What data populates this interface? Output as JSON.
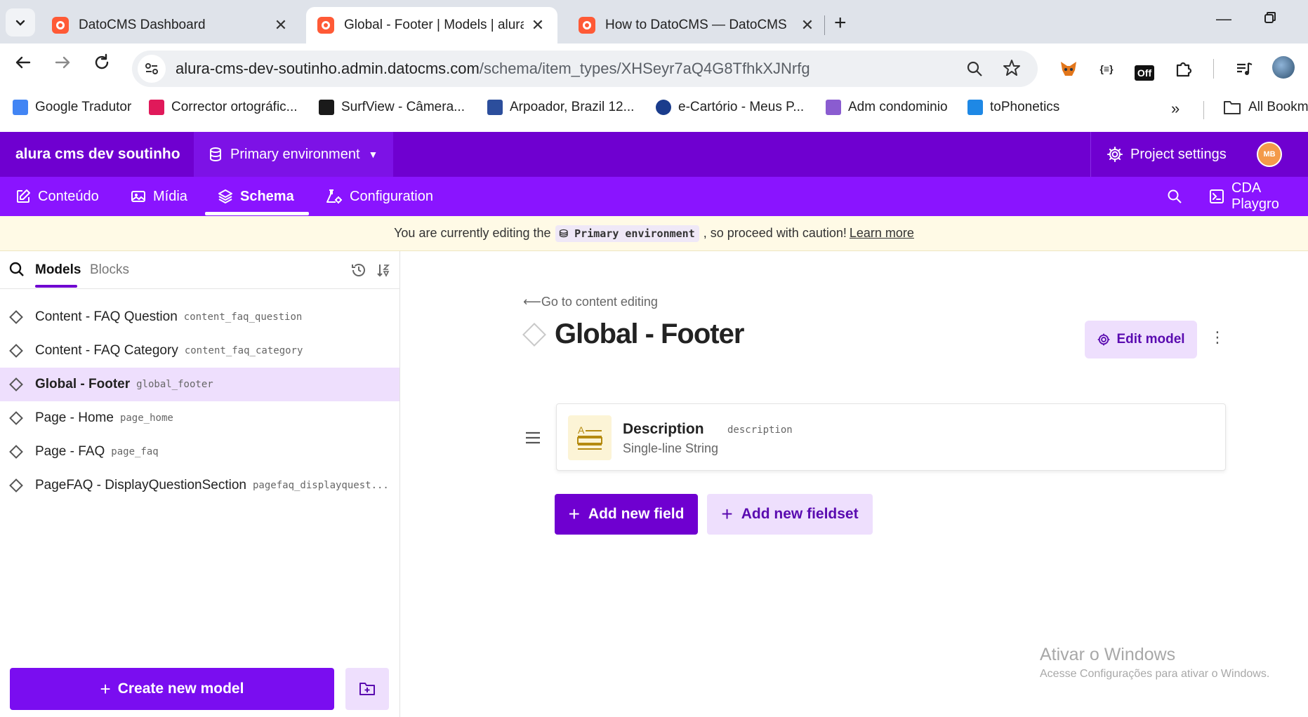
{
  "browser": {
    "tabs": [
      {
        "title": "DatoCMS Dashboard"
      },
      {
        "title": "Global - Footer | Models | alura"
      },
      {
        "title": "How to DatoCMS — DatoCMS"
      }
    ],
    "url_host": "alura-cms-dev-soutinho.admin.datocms.com",
    "url_path": "/schema/item_types/XHSeyr7aQ4G8TfhkXJNrfg",
    "extension_badge": "Off",
    "bookmarks": [
      {
        "label": "Google Tradutor",
        "color": "#4285f4"
      },
      {
        "label": "Corrector ortográfic...",
        "color": "#e0195a"
      },
      {
        "label": "SurfView - Câmera...",
        "color": "#1a1a1a"
      },
      {
        "label": "Arpoador, Brazil 12...",
        "color": "#2c4e9c"
      },
      {
        "label": "e-Cartório - Meus P...",
        "color": "#1a3c8c"
      },
      {
        "label": "Adm condominio",
        "color": "#8a5cd0"
      },
      {
        "label": "toPhonetics",
        "color": "#1e88e5"
      }
    ],
    "all_bookmarks": "All Bookm"
  },
  "app": {
    "project_name": "alura cms dev soutinho",
    "environment": "Primary environment",
    "project_settings": "Project settings",
    "avatar_initials": "MB",
    "nav": {
      "content": "Conteúdo",
      "media": "Mídia",
      "schema": "Schema",
      "configuration": "Configuration",
      "cda_playground": "CDA Playgro"
    },
    "colors": {
      "top_bar": "#6f00d0",
      "nav_bar": "#8a14ff",
      "accent": "#7a0df0",
      "accent_light": "#eedffd"
    }
  },
  "warning": {
    "prefix": "You are currently editing the",
    "env": "Primary environment",
    "suffix": ", so proceed with caution!",
    "link": "Learn more"
  },
  "sidebar": {
    "tabs": {
      "models": "Models",
      "blocks": "Blocks"
    },
    "models": [
      {
        "name": "Content - FAQ Question",
        "api": "content_faq_question",
        "selected": false
      },
      {
        "name": "Content - FAQ Category",
        "api": "content_faq_category",
        "selected": false
      },
      {
        "name": "Global - Footer",
        "api": "global_footer",
        "selected": true
      },
      {
        "name": "Page - Home",
        "api": "page_home",
        "selected": false
      },
      {
        "name": "Page - FAQ",
        "api": "page_faq",
        "selected": false
      },
      {
        "name": "PageFAQ - DisplayQuestionSection",
        "api": "pagefaq_displayquest...",
        "selected": false
      }
    ],
    "create_model": "Create new model"
  },
  "main": {
    "back_link": "Go to content editing",
    "title": "Global - Footer",
    "edit_model": "Edit model",
    "fields": [
      {
        "name": "Description",
        "api": "description",
        "type": "Single-line String"
      }
    ],
    "add_field": "Add new field",
    "add_fieldset": "Add new fieldset"
  },
  "os_watermark": {
    "title": "Ativar o Windows",
    "subtitle": "Acesse Configurações para ativar o Windows."
  }
}
